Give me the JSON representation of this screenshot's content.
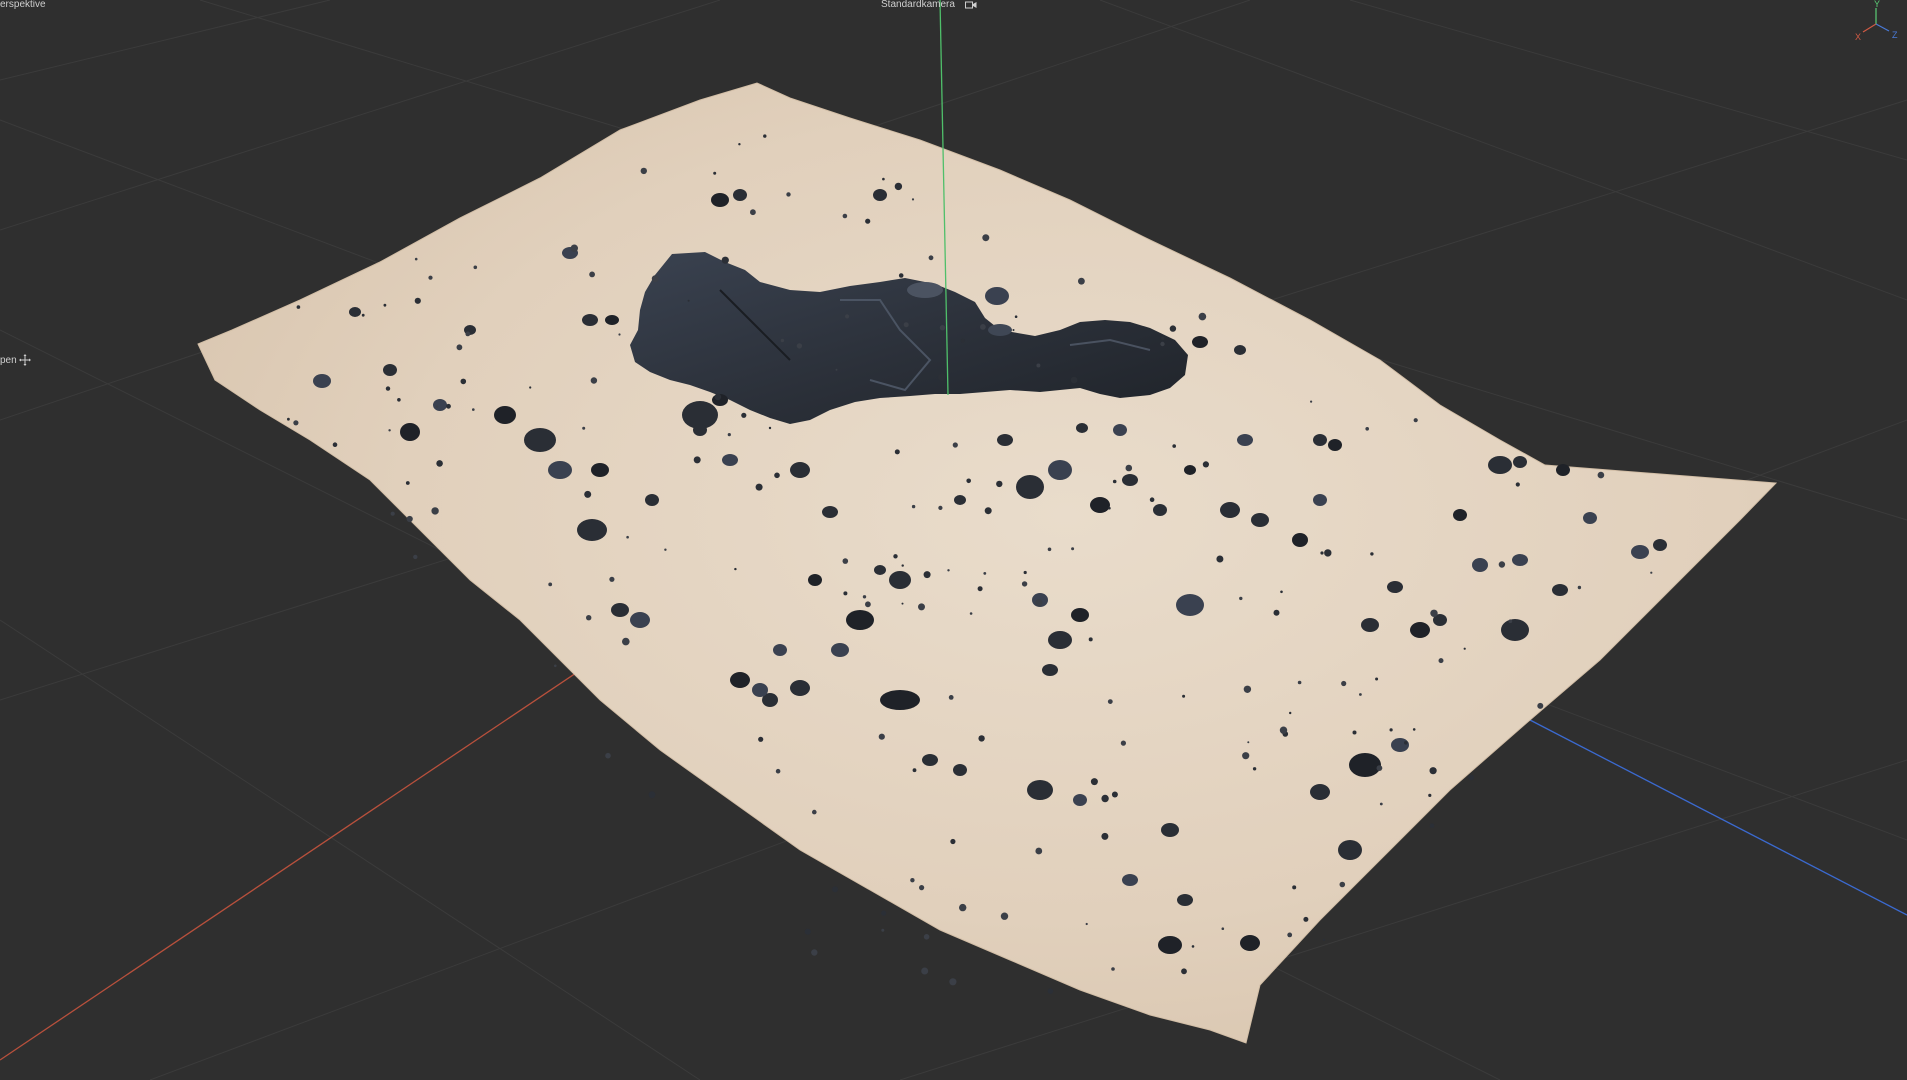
{
  "viewport": {
    "view_name": "erspektive",
    "camera_name": "Standardkamera",
    "side_label": "pen",
    "axes": {
      "x": "X",
      "y": "Y",
      "z": "Z"
    },
    "colors": {
      "background": "#2f2f2f",
      "grid": "#3d3d3d",
      "x_axis": "#c8553f",
      "y_axis": "#4fbf6a",
      "z_axis": "#3e6fd0",
      "sand": "#e3d3c0",
      "rock": "#2c3038"
    }
  }
}
